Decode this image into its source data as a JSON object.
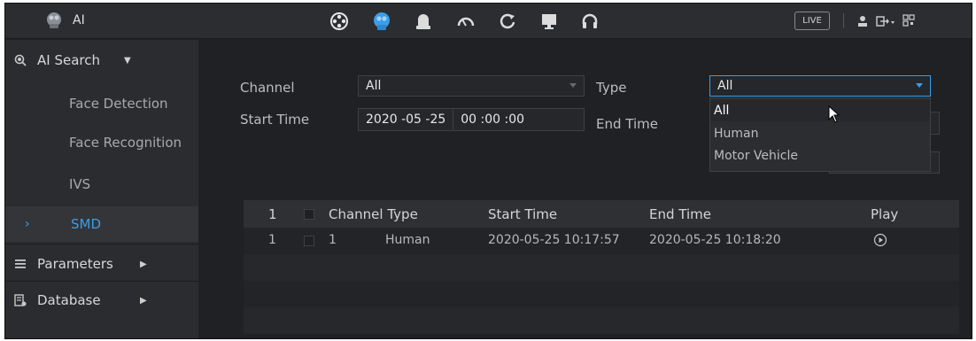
{
  "app": {
    "title": "AI"
  },
  "topbar": {
    "icons": [
      "film-reel-icon",
      "ai-brain-icon",
      "alarm-bell-icon",
      "speedometer-icon",
      "refresh-icon",
      "monitor-icon",
      "headset-icon"
    ],
    "live_label": "LIVE",
    "right_icons": [
      "user-icon",
      "logout-icon",
      "qr-code-icon"
    ]
  },
  "sidebar": {
    "ai_search": "AI Search",
    "items": [
      {
        "label": "Face Detection"
      },
      {
        "label": "Face Recognition"
      },
      {
        "label": "IVS"
      },
      {
        "label": "SMD"
      }
    ],
    "parameters": "Parameters",
    "database": "Database"
  },
  "filters": {
    "channel_label": "Channel",
    "channel_value": "All",
    "type_label": "Type",
    "type_value": "All",
    "start_time_label": "Start Time",
    "start_date": "2020 -05 -25",
    "start_clock": "00 :00 :00",
    "end_time_label": "End Time",
    "type_options": [
      "All",
      "Human",
      "Motor Vehicle"
    ]
  },
  "table": {
    "headers": {
      "index": "1",
      "channel_type": "Channel Type",
      "start_time": "Start Time",
      "end_time": "End Time",
      "play": "Play"
    },
    "rows": [
      {
        "index": "1",
        "channel": "1",
        "type": "Human",
        "start": "2020-05-25 10:17:57",
        "end": "2020-05-25 10:18:20"
      }
    ]
  },
  "colors": {
    "accent": "#3a9de8",
    "background": "#1f2124",
    "sidebar": "#2a2c30"
  }
}
